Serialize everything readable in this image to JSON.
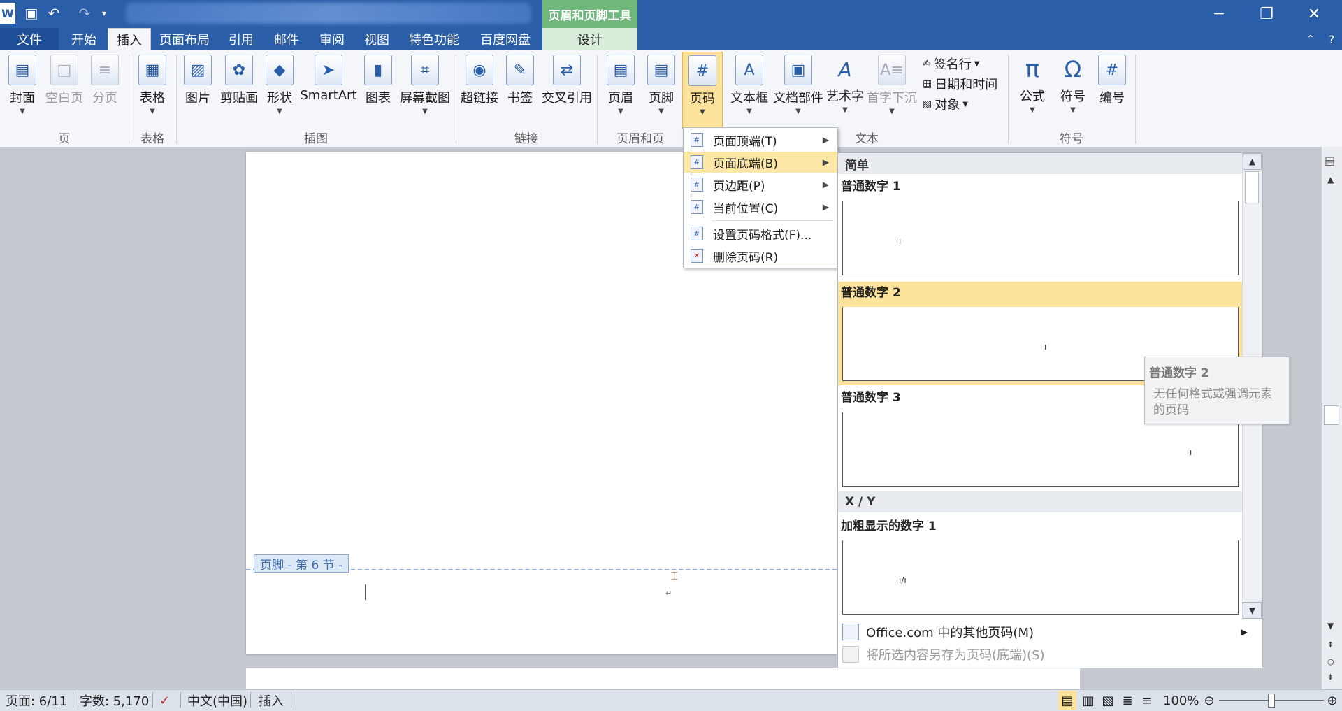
{
  "qat": {
    "app_icon": "W",
    "save_icon": "save-icon",
    "undo_icon": "undo-icon",
    "redo_icon": "redo-icon",
    "customize_icon": "customize-icon"
  },
  "contextual_title": "页眉和页脚工具",
  "window_controls": {
    "minimize": "─",
    "restore": "❐",
    "close": "✕"
  },
  "tabs": {
    "file": "文件",
    "home": "开始",
    "insert": "插入",
    "layout": "页面布局",
    "references": "引用",
    "mailings": "邮件",
    "review": "审阅",
    "view": "视图",
    "special": "特色功能",
    "baidu": "百度网盘",
    "design": "设计"
  },
  "ribbon": {
    "cover": "封面",
    "blank": "空白页",
    "pagebreak": "分页",
    "table": "表格",
    "picture": "图片",
    "clipart": "剪贴画",
    "shapes": "形状",
    "smartart": "SmartArt",
    "chart": "图表",
    "screenshot": "屏幕截图",
    "hyperlink": "超链接",
    "bookmark": "书签",
    "crossref": "交叉引用",
    "header": "页眉",
    "footer": "页脚",
    "pagenum": "页码",
    "textbox": "文本框",
    "quickparts": "文档部件",
    "wordart": "艺术字",
    "dropcap": "首字下沉",
    "sigline": "签名行",
    "datetime": "日期和时间",
    "object": "对象",
    "equation": "公式",
    "symbol": "符号",
    "number": "编号",
    "groups": {
      "pages": "页",
      "tables": "表格",
      "illustrations": "插图",
      "links": "链接",
      "headerfooter": "页眉和页",
      "text": "文本",
      "symbols": "符号"
    }
  },
  "menu": {
    "top": "页面顶端(T)",
    "bottom": "页面底端(B)",
    "margin": "页边距(P)",
    "current": "当前位置(C)",
    "format": "设置页码格式(F)...",
    "remove": "删除页码(R)"
  },
  "gallery": {
    "section_simple": "简单",
    "plain1": "普通数字 1",
    "plain2": "普通数字 2",
    "plain3": "普通数字 3",
    "section_xy": "X / Y",
    "bold1": "加粗显示的数字 1",
    "office_more": "Office.com 中的其他页码(M)",
    "save_selection": "将所选内容另存为页码(底端)(S)"
  },
  "tooltip": {
    "title": "普通数字 2",
    "desc": "无任何格式或强调元素的页码"
  },
  "document": {
    "footer_tag": "页脚 - 第 6 节 -"
  },
  "status": {
    "page": "页面: 6/11",
    "words": "字数: 5,170",
    "language": "中文(中国)",
    "mode": "插入",
    "zoom": "100%"
  }
}
